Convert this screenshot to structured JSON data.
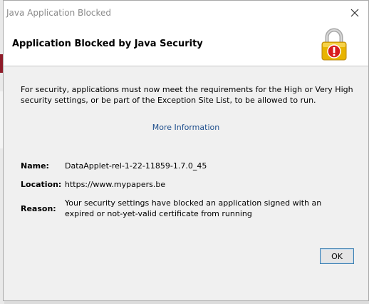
{
  "window": {
    "title": "Java Application Blocked",
    "close_icon": "close-icon"
  },
  "header": {
    "title": "Application Blocked by Java Security",
    "icon": "padlock-warning-icon"
  },
  "message": "For security, applications must now meet the requirements for the High or Very High security settings, or be part of the Exception Site List, to be allowed to run.",
  "more_info_link": "More Information",
  "details": {
    "name_label": "Name:",
    "name_value": "DataApplet-rel-1-22-11859-1.7.0_45",
    "location_label": "Location:",
    "location_value": "https://www.mypapers.be",
    "reason_label": "Reason:",
    "reason_value": "Your security settings have blocked an application signed with an expired or not-yet-valid certificate from running"
  },
  "buttons": {
    "ok_label": "OK"
  },
  "colors": {
    "link": "#1e4e8c",
    "lock_gold": "#e8b400",
    "warning_red": "#d81e1e",
    "ok_border": "#3c7fb1"
  }
}
